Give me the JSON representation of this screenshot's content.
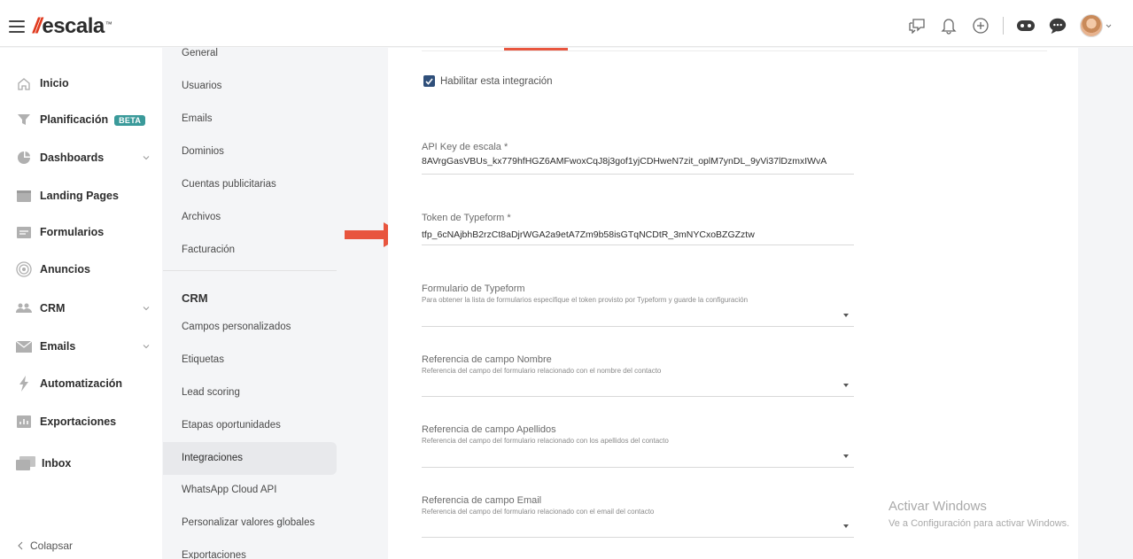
{
  "app": {
    "brand": "escala",
    "brand_tm": "™"
  },
  "topbar": {
    "icons": [
      "chat-icon",
      "bell-icon",
      "plus-circle-icon",
      "gamepad-icon",
      "support-chat-icon"
    ]
  },
  "sidebar": {
    "items": [
      {
        "label": "Inicio",
        "icon": "home-icon"
      },
      {
        "label": "Planificación",
        "icon": "funnel-icon",
        "badge": "BETA"
      },
      {
        "label": "Dashboards",
        "icon": "pie-chart-icon",
        "expandable": true
      },
      {
        "label": "Landing Pages",
        "icon": "page-icon"
      },
      {
        "label": "Formularios",
        "icon": "form-icon"
      },
      {
        "label": "Anuncios",
        "icon": "target-icon"
      },
      {
        "label": "CRM",
        "icon": "users-icon",
        "expandable": true
      },
      {
        "label": "Emails",
        "icon": "mail-icon",
        "expandable": true
      },
      {
        "label": "Automatización",
        "icon": "lightning-icon"
      },
      {
        "label": "Exportaciones",
        "icon": "export-icon"
      },
      {
        "label": "Inbox",
        "icon": "inbox-icon"
      }
    ],
    "collapse_label": "Colapsar"
  },
  "submenu": {
    "general_items": [
      "General",
      "Usuarios",
      "Emails",
      "Dominios",
      "Cuentas publicitarias",
      "Archivos",
      "Facturación"
    ],
    "crm_section": "CRM",
    "crm_items": [
      "Campos personalizados",
      "Etiquetas",
      "Lead scoring",
      "Etapas oportunidades",
      "Integraciones",
      "WhatsApp Cloud API",
      "Personalizar valores globales",
      "Exportaciones"
    ],
    "active": "Integraciones"
  },
  "form": {
    "enable_label": "Habilitar esta integración",
    "enable_checked": true,
    "api_key": {
      "label": "API Key de escala *",
      "value": "8AVrgGasVBUs_kx779hfHGZ6AMFwoxCqJ8j3gof1yjCDHweN7zit_oplM7ynDL_9yVi37lDzmxIWvA"
    },
    "token": {
      "label": "Token de Typeform *",
      "value": "tfp_6cNAjbhB2rzCt8aDjrWGA2a9etA7Zm9b58isGTqNCDtR_3mNYCxoBZGZztw"
    },
    "form_select": {
      "label": "Formulario de Typeform",
      "help": "Para obtener la lista de formularios especifique el token provisto por Typeform y guarde la configuración"
    },
    "name_ref": {
      "label": "Referencia de campo Nombre",
      "help": "Referencia del campo del formulario relacionado con el nombre del contacto"
    },
    "surname_ref": {
      "label": "Referencia de campo Apellidos",
      "help": "Referencia del campo del formulario relacionado con los apellidos del contacto"
    },
    "email_ref": {
      "label": "Referencia de campo Email",
      "help": "Referencia del campo del formulario relacionado con el email del contacto"
    }
  },
  "watermark": {
    "title": "Activar Windows",
    "subtitle": "Ve a Configuración para activar Windows."
  },
  "colors": {
    "accent": "#e8553e",
    "badge": "#3a9a9a",
    "checkbox": "#2f4f7a"
  }
}
